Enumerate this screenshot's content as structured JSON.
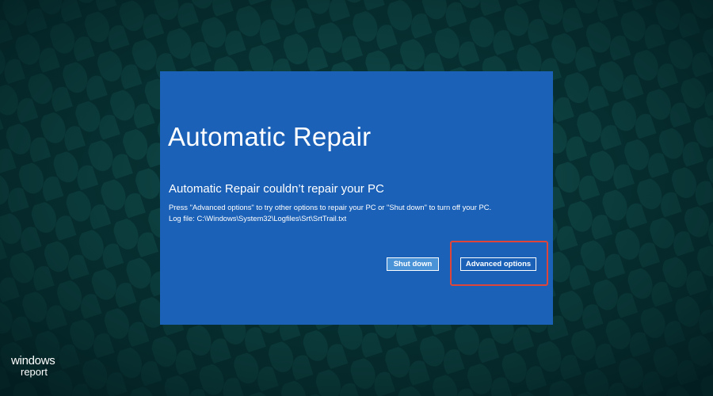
{
  "repair_dialog": {
    "title": "Automatic Repair",
    "subtitle": "Automatic Repair couldn’t repair your PC",
    "message": "Press \"Advanced options\" to try other options to repair your PC or \"Shut down\" to turn off your PC.",
    "log_file": "Log file: C:\\Windows\\System32\\Logfiles\\Srt\\SrtTrail.txt",
    "buttons": {
      "shut_down": "Shut down",
      "advanced_options": "Advanced options"
    }
  },
  "highlight": {
    "target": "advanced_options",
    "color": "#e0453a"
  },
  "watermark": {
    "line1": "windows",
    "line2": "report"
  },
  "colors": {
    "dialog_background": "#1b61b7",
    "page_background": "#062a2c"
  }
}
